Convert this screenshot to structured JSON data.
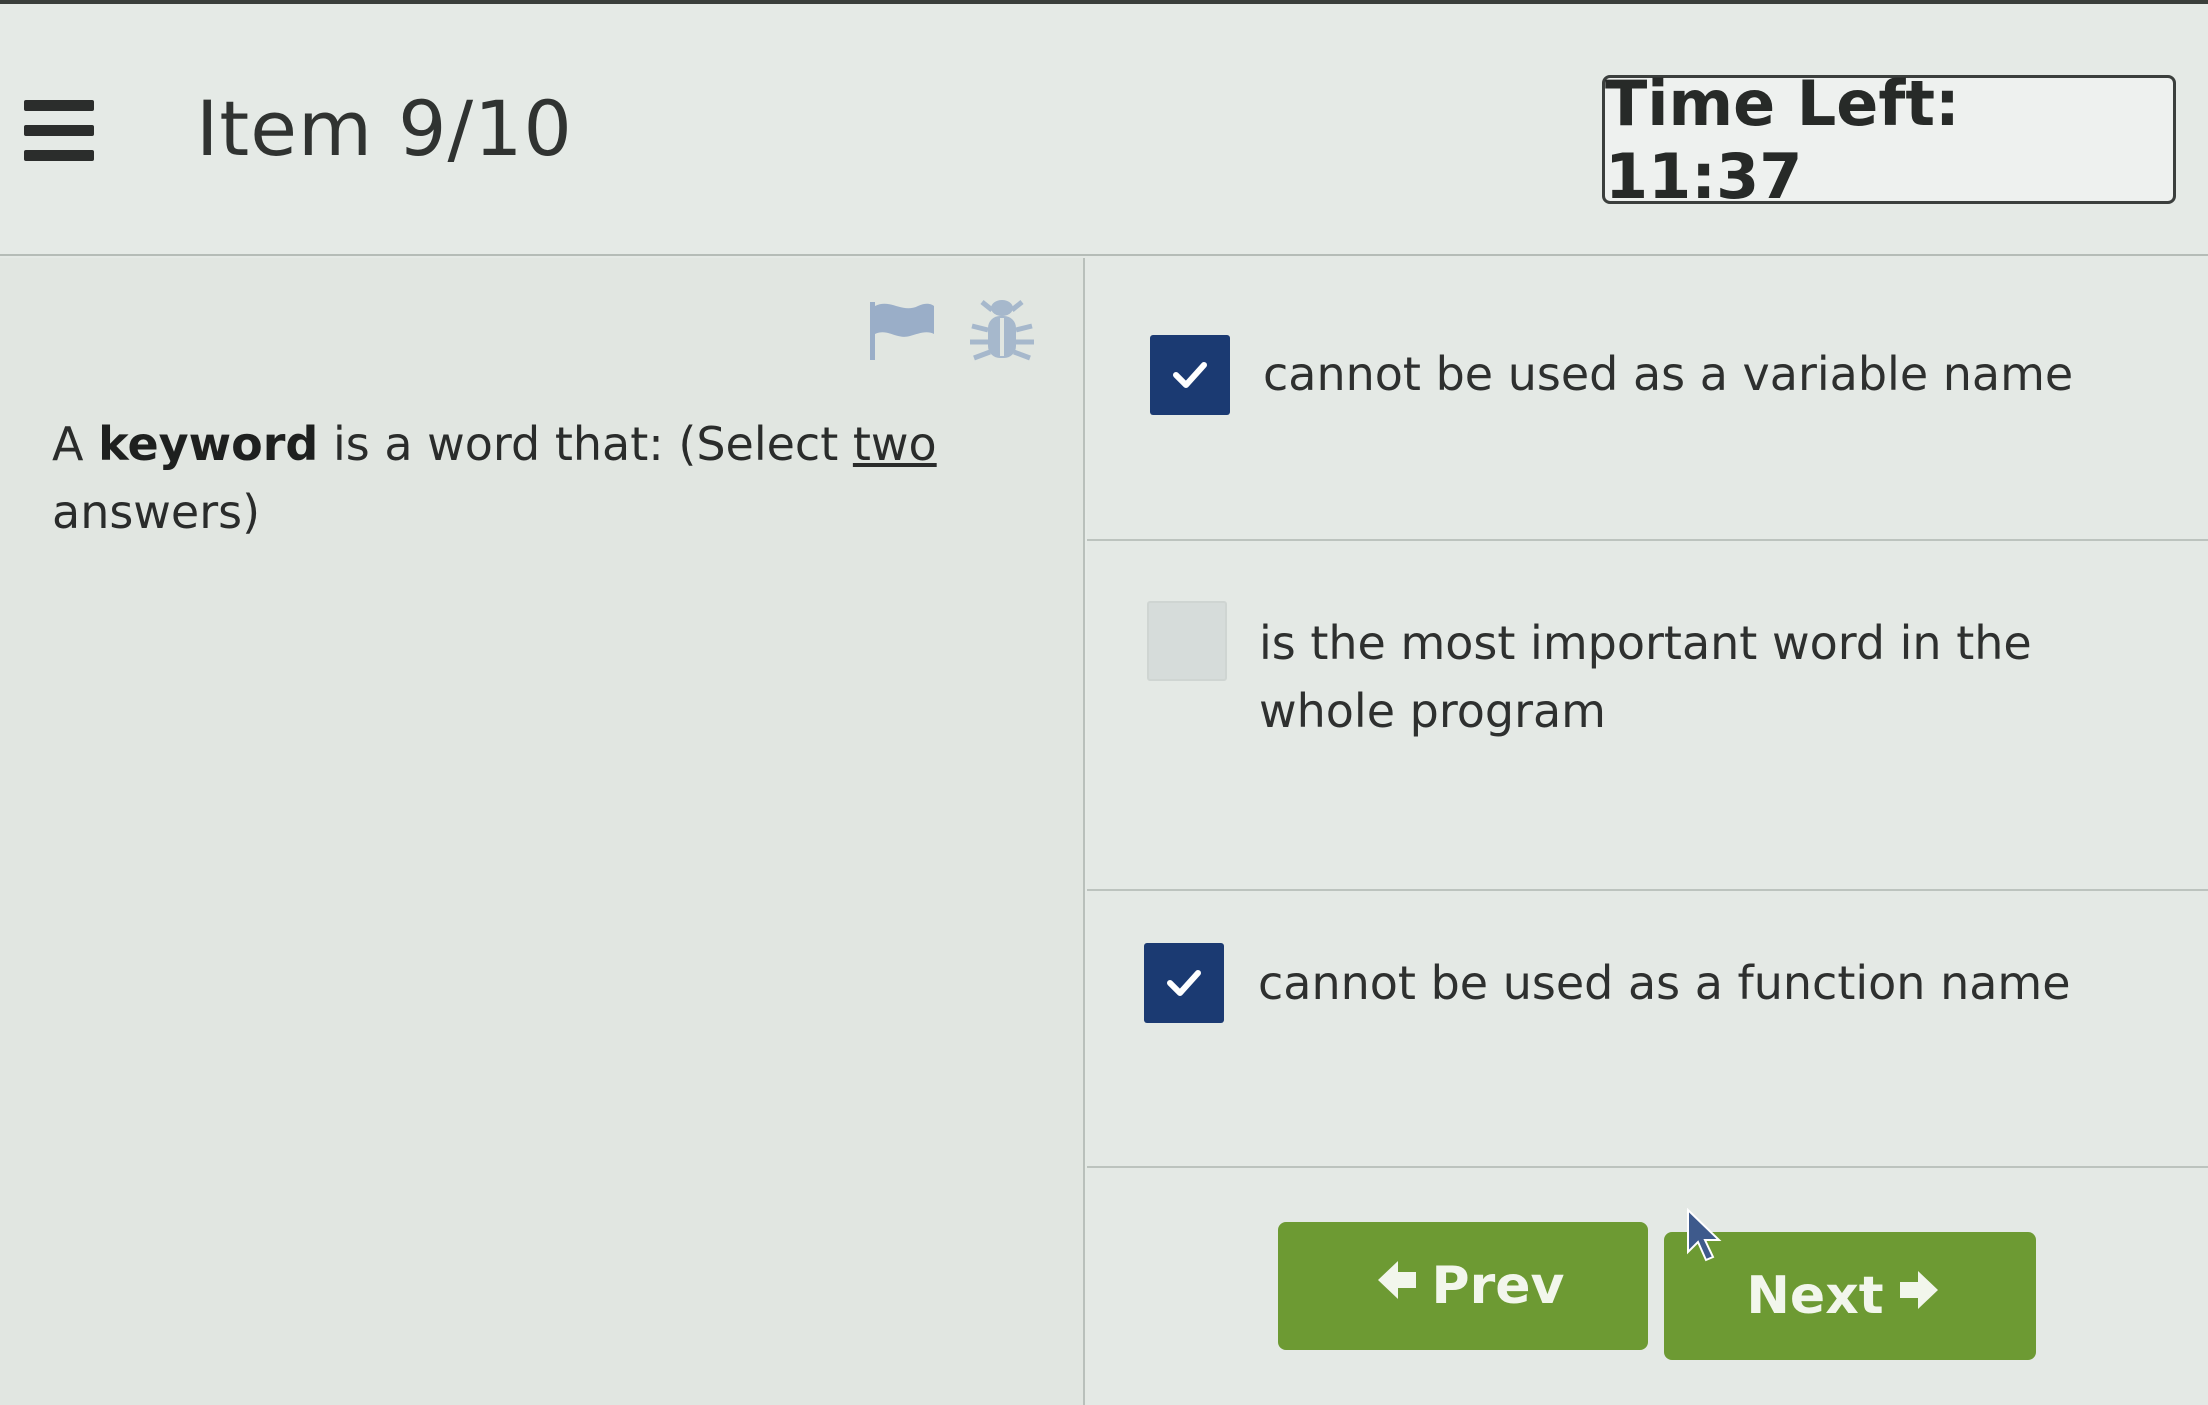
{
  "header": {
    "item_label": "Item 9/10",
    "timer_label": "Time Left: 11:37"
  },
  "question": {
    "prefix": "A ",
    "keyword": "keyword",
    "middle": " is a word that: (Select ",
    "count": "two",
    "suffix": " answers)"
  },
  "options": [
    {
      "label": "cannot be used as a variable name",
      "checked": true
    },
    {
      "label": "is the most important word in the whole program",
      "checked": false
    },
    {
      "label": "cannot be used as a function name",
      "checked": true
    }
  ],
  "nav": {
    "prev_label": "Prev",
    "next_label": "Next"
  },
  "colors": {
    "checkbox_checked": "#1b3a72",
    "button_green": "#6d9a33"
  },
  "icons": [
    "menu-icon",
    "flag-icon",
    "bug-icon",
    "check-icon",
    "arrow-left-icon",
    "arrow-right-icon",
    "mouse-cursor-icon"
  ]
}
